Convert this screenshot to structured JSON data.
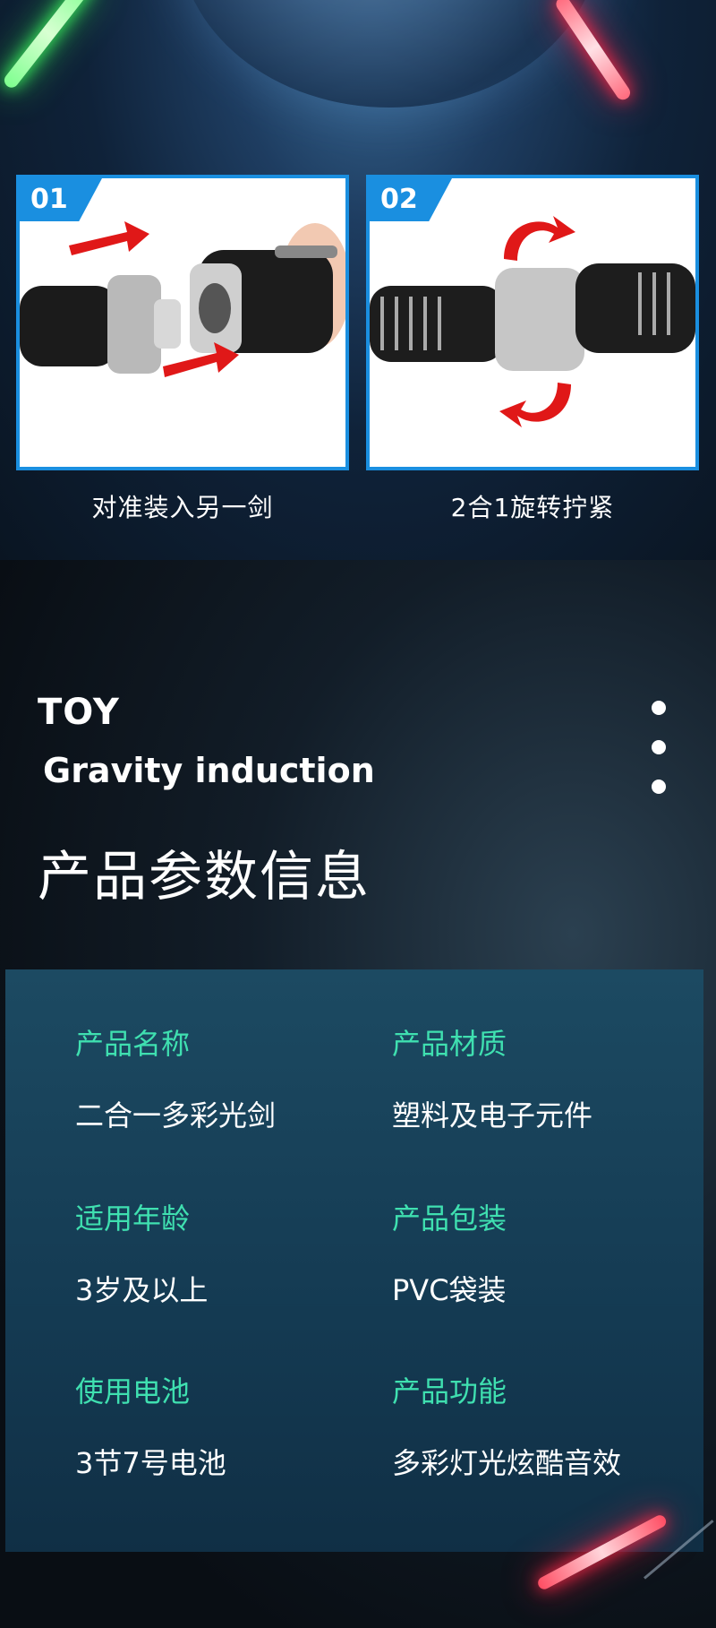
{
  "steps": [
    {
      "number": "01",
      "caption": "对准装入另一剑"
    },
    {
      "number": "02",
      "caption": "2合1旋转拧紧"
    }
  ],
  "header": {
    "toy": "TOY",
    "subtitle": "Gravity induction",
    "title": "产品参数信息"
  },
  "specs": [
    {
      "label": "产品名称",
      "value": "二合一多彩光剑"
    },
    {
      "label": "产品材质",
      "value": "塑料及电子元件"
    },
    {
      "label": "适用年龄",
      "value": "3岁及以上"
    },
    {
      "label": "产品包装",
      "value": "PVC袋装"
    },
    {
      "label": "使用电池",
      "value": "3节7号电池"
    },
    {
      "label": "产品功能",
      "value": "多彩灯光炫酷音效"
    }
  ],
  "colors": {
    "accent_blue": "#1a8fe0",
    "label_green": "#3fe0b0"
  },
  "icons": [
    "saber-green-icon",
    "saber-red-icon",
    "rotate-arrow-icon",
    "dots-icon"
  ]
}
